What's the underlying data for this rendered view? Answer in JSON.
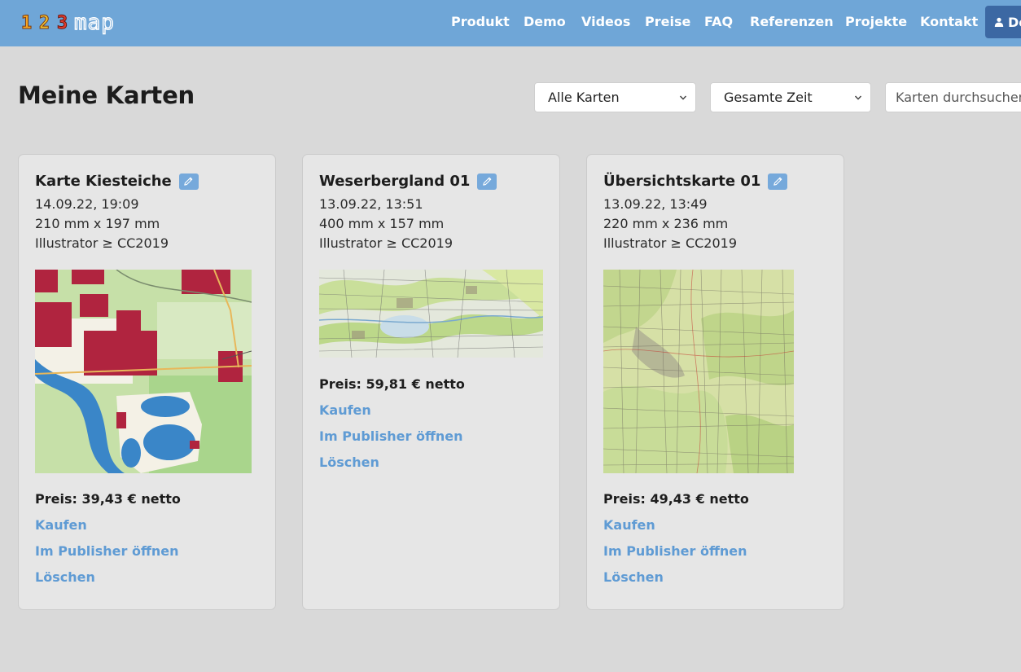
{
  "header": {
    "logo": {
      "digits": [
        "1",
        "2",
        "3"
      ],
      "word": "map"
    },
    "nav": [
      "Produkt",
      "Demo",
      "Videos",
      "Preise",
      "FAQ",
      "Referenzen",
      "Projekte",
      "Kontakt"
    ],
    "user_button_label": "De",
    "user_icon": "person-icon"
  },
  "page": {
    "title": "Meine Karten"
  },
  "filters": {
    "map_filter": "Alle Karten",
    "time_filter": "Gesamte Zeit",
    "search_placeholder": "Karten durchsuchen"
  },
  "colors": {
    "header_bg": "#6fa6d7",
    "accent_link": "#5f9bd4",
    "edit_button": "#76a9db",
    "page_bg": "#d9d9d9",
    "card_bg": "#e6e6e6"
  },
  "cards": [
    {
      "title": "Karte Kiesteiche",
      "date": "14.09.22, 19:09",
      "size": "210 mm x 197 mm",
      "format": "Illustrator ≥ CC2019",
      "price": "Preis: 39,43 € netto",
      "buy": "Kaufen",
      "open": "Im Publisher öffnen",
      "delete": "Löschen"
    },
    {
      "title": "Weserbergland 01",
      "date": "13.09.22, 13:51",
      "size": "400 mm x 157 mm",
      "format": "Illustrator ≥ CC2019",
      "price": "Preis: 59,81 € netto",
      "buy": "Kaufen",
      "open": "Im Publisher öffnen",
      "delete": "Löschen"
    },
    {
      "title": "Übersichtskarte 01",
      "date": "13.09.22, 13:49",
      "size": "220 mm x 236 mm",
      "format": "Illustrator ≥ CC2019",
      "price": "Preis: 49,43 € netto",
      "buy": "Kaufen",
      "open": "Im Publisher öffnen",
      "delete": "Löschen"
    }
  ]
}
